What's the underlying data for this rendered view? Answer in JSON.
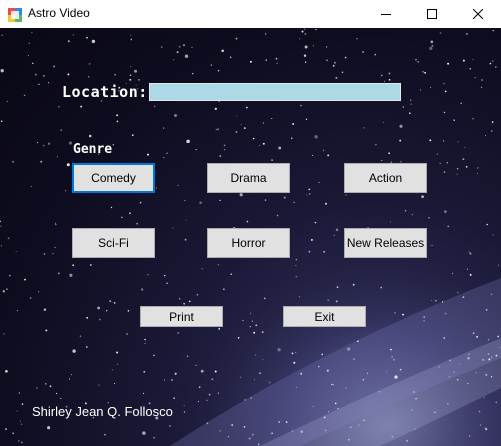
{
  "window": {
    "title": "Astro Video",
    "icons": {
      "app": "app-icon",
      "minimize": "minimize-icon",
      "maximize": "maximize-icon",
      "close": "close-icon"
    }
  },
  "form": {
    "location_label": "Location:",
    "location_value": "",
    "genre_label": "Genre"
  },
  "genres": {
    "comedy": "Comedy",
    "drama": "Drama",
    "action": "Action",
    "scifi": "Sci-Fi",
    "horror": "Horror",
    "new_releases": "New Releases"
  },
  "actions": {
    "print": "Print",
    "exit": "Exit"
  },
  "footer": {
    "author": "Shirley Jean Q. Follosco"
  },
  "colors": {
    "input_bg": "#add8e6",
    "button_bg": "#e1e1e1",
    "focus_border": "#0078d7"
  }
}
